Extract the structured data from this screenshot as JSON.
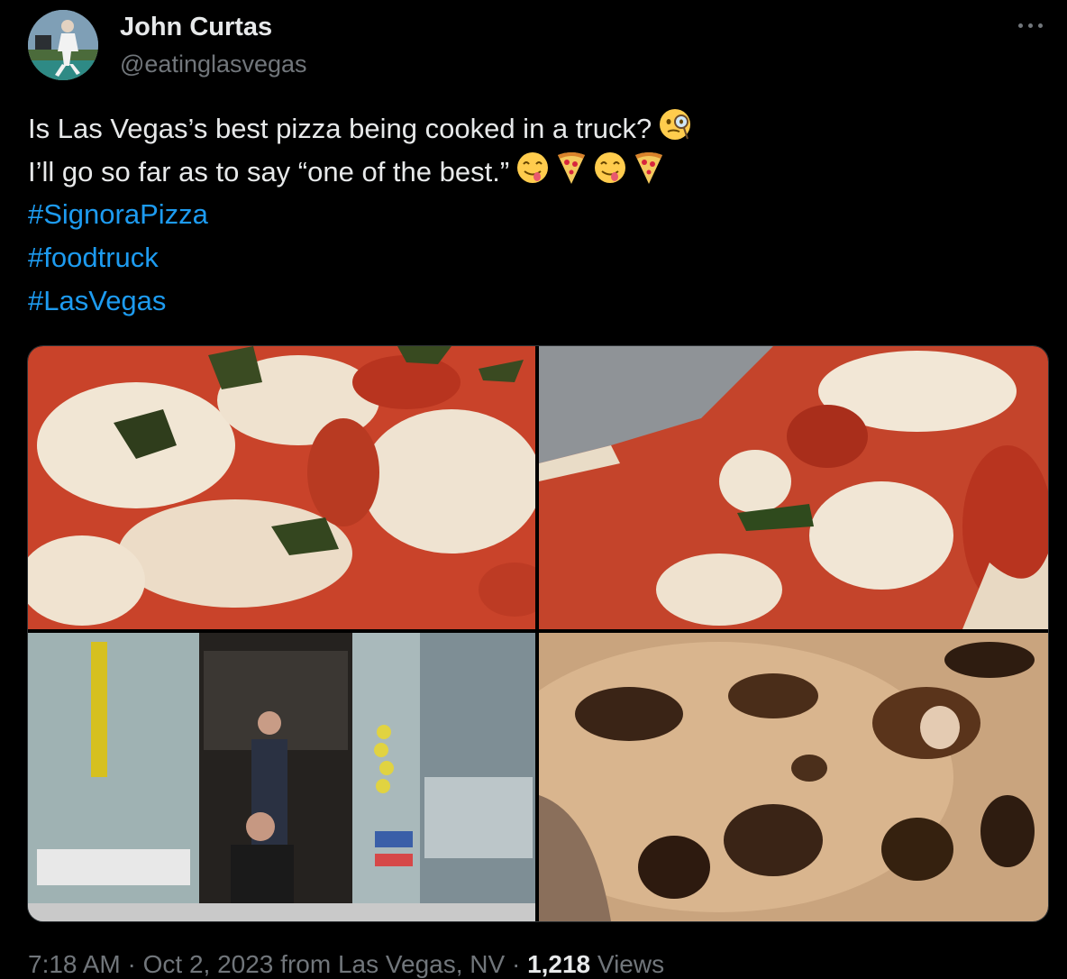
{
  "author": {
    "name": "John Curtas",
    "handle": "@eatinglasvegas"
  },
  "tweet": {
    "line1": "Is Las Vegas’s best pizza being cooked in a truck?",
    "line1_emoji": "face-with-monocle",
    "line2": "I’ll go so far as to say “one of the best.”",
    "line2_emojis": [
      "face-savoring-food",
      "pizza",
      "face-savoring-food",
      "pizza"
    ],
    "hashtags": [
      "#SignoraPizza",
      "#foodtruck",
      "#LasVegas"
    ]
  },
  "photos": [
    {
      "subject": "margherita pizza closeup with basil"
    },
    {
      "subject": "pizza with tomato sauce and mozzarella on metal tray"
    },
    {
      "subject": "food truck service window with staff"
    },
    {
      "subject": "charred pizza crust underside"
    }
  ],
  "footer": {
    "time": "7:18 AM",
    "sep1": " · ",
    "date_location": "Oct 2, 2023 from Las Vegas, NV",
    "sep2": " · ",
    "views_count": "1,218",
    "views_label": " Views"
  },
  "colors": {
    "background": "#000000",
    "text": "#e7e9ea",
    "secondary": "#71767b",
    "link": "#1d9bf0"
  }
}
